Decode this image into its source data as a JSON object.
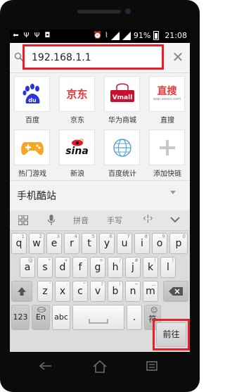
{
  "status_bar": {
    "time": "21:08",
    "battery": "91%"
  },
  "url_bar": {
    "value": "192.168.1.1"
  },
  "shortcuts": [
    {
      "label": "百度",
      "icon": "baidu-logo",
      "logo_text": "du"
    },
    {
      "label": "京东",
      "icon": "jd-logo",
      "logo_text": "京东"
    },
    {
      "label": "华为商城",
      "icon": "vmall-logo",
      "logo_text": "Vmall"
    },
    {
      "label": "直搜",
      "icon": "zhisou-logo",
      "logo_text": "直搜",
      "logo_sub": "wap.easou.com"
    },
    {
      "label": "热门游戏",
      "icon": "gamepad-icon"
    },
    {
      "label": "新浪",
      "icon": "sina-logo",
      "logo_text": "sina"
    },
    {
      "label": "百度统计",
      "icon": "globe-icon"
    },
    {
      "label": "添加快链",
      "icon": "plus-icon"
    }
  ],
  "mobile_sites": {
    "title": "手机酷站"
  },
  "keyboard": {
    "toolbar": {
      "pinyin": "拼音",
      "handwrite": "手写"
    },
    "row1": [
      {
        "k": "q",
        "s": "1"
      },
      {
        "k": "w",
        "s": "2"
      },
      {
        "k": "e",
        "s": "3"
      },
      {
        "k": "r",
        "s": "4"
      },
      {
        "k": "t",
        "s": "5"
      },
      {
        "k": "y",
        "s": "6"
      },
      {
        "k": "u",
        "s": "7"
      },
      {
        "k": "i",
        "s": "8"
      },
      {
        "k": "o",
        "s": "9"
      },
      {
        "k": "p",
        "s": "0"
      }
    ],
    "row2": [
      {
        "k": "a",
        "s": "@"
      },
      {
        "k": "s",
        "s": "*"
      },
      {
        "k": "d",
        "s": "+"
      },
      {
        "k": "f",
        "s": "-"
      },
      {
        "k": "g",
        "s": "="
      },
      {
        "k": "h",
        "s": "/"
      },
      {
        "k": "j",
        "s": "#"
      },
      {
        "k": "k",
        "s": "("
      },
      {
        "k": "l",
        "s": ")"
      }
    ],
    "row3": [
      {
        "k": "z",
        "s": "'"
      },
      {
        "k": "x",
        "s": ":"
      },
      {
        "k": "c",
        "s": "\""
      },
      {
        "k": "v",
        "s": "?"
      },
      {
        "k": "b",
        "s": "!"
      },
      {
        "k": "n",
        "s": "~"
      },
      {
        "k": "m",
        "s": "..."
      }
    ],
    "num_key": "123",
    "lang_key": "En",
    "abc_key": "abc",
    "period_key": ".",
    "symbol_key": "符",
    "enter_key": "前往"
  },
  "colors": {
    "highlight": "#e8202a",
    "baidu_blue": "#2932e1",
    "jd_red": "#e4393c",
    "vmall_red": "#c8102e",
    "sina_red": "#e6162d",
    "game_orange": "#f5a623"
  }
}
